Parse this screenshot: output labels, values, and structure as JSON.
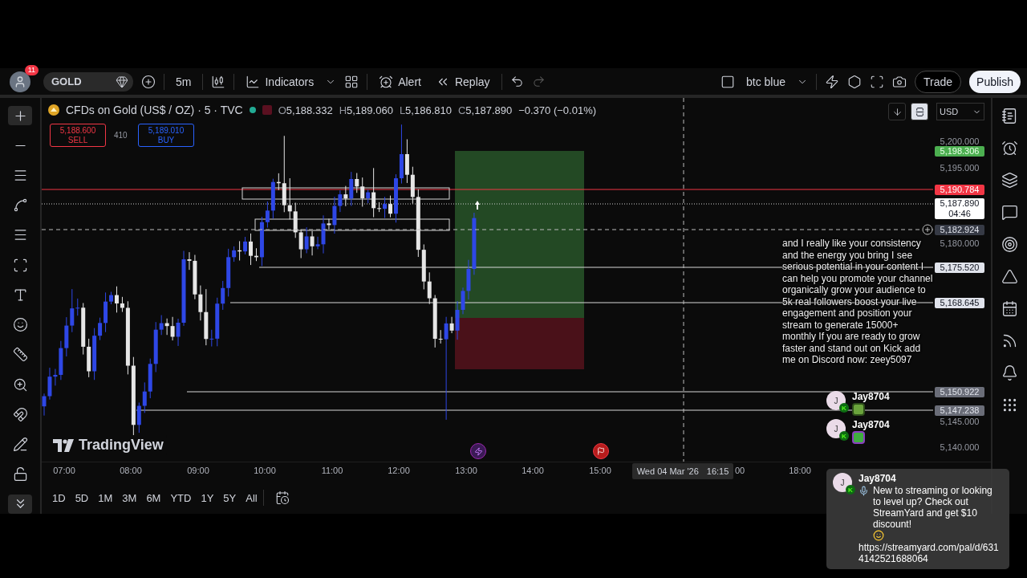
{
  "toolbar": {
    "notification_count": "11",
    "symbol": "GOLD",
    "interval": "5m",
    "indicators": "Indicators",
    "alert": "Alert",
    "replay": "Replay",
    "layout_name": "btc blue",
    "trade": "Trade",
    "publish": "Publish"
  },
  "legend": {
    "title": "CFDs on Gold (US$ / OZ) · 5 · TVC",
    "ohlc": [
      {
        "label": "O",
        "value": "5,188.332"
      },
      {
        "label": "H",
        "value": "5,189.060"
      },
      {
        "label": "L",
        "value": "5,186.810"
      },
      {
        "label": "C",
        "value": "5,187.890"
      }
    ],
    "change": "−0.370 (−0.01%)"
  },
  "order_panel": {
    "sell_price": "5,188.600",
    "sell_label": "SELL",
    "spread": "410",
    "buy_price": "5,189.010",
    "buy_label": "BUY"
  },
  "price_axis": {
    "currency": "USD",
    "labels": [
      {
        "text": "5,200.000",
        "kind": "tick"
      },
      {
        "text": "5,198.306",
        "kind": "target"
      },
      {
        "text": "5,195.000",
        "kind": "tick"
      },
      {
        "text": "5,190.784",
        "kind": "stop"
      },
      {
        "text": "5,187.890",
        "countdown": "04:46",
        "kind": "last"
      },
      {
        "text": "5,182.924",
        "kind": "crosshair"
      },
      {
        "text": "5,180.000",
        "kind": "tick"
      },
      {
        "text": "5,175.520",
        "kind": "line"
      },
      {
        "text": "5,168.645",
        "kind": "line"
      },
      {
        "text": "5,150.922",
        "kind": "muted"
      },
      {
        "text": "5,147.238",
        "kind": "muted"
      },
      {
        "text": "5,145.000",
        "kind": "tick"
      },
      {
        "text": "5,140.000",
        "kind": "tick"
      }
    ]
  },
  "brand": "TradingView",
  "time_axis": {
    "labels": [
      "07:00",
      "08:00",
      "09:00",
      "10:00",
      "11:00",
      "12:00",
      "13:00",
      "14:00",
      "15:00",
      "00",
      "18:00"
    ],
    "crosshair_date": "Wed 04 Mar '26",
    "crosshair_time": "16:15"
  },
  "ranges": [
    "1D",
    "5D",
    "1M",
    "3M",
    "6M",
    "YTD",
    "1Y",
    "5Y",
    "All"
  ],
  "chat": {
    "intro": "and I really like your consistency and the energy you bring I see serious potential in your content I can help you promote your channel organically grow your audience to 5k real followers boost your live engagement and position your stream to generate 15000+ monthly If you are ready to grow faster and stand out on Kick add me on Discord now: zeey5097",
    "messages": [
      {
        "kind": "emote",
        "avatar_letter": "J",
        "badge": "K",
        "user": "Jay8704"
      },
      {
        "kind": "emote",
        "avatar_letter": "J",
        "badge": "K",
        "user": "Jay8704"
      },
      {
        "kind": "text",
        "avatar_letter": "J",
        "badge": "K",
        "user": "Jay8704",
        "text": "New to streaming or looking to level up? Check out StreamYard and get $10 discount!",
        "link": "https://streamyard.com/pal/d/6314142521688064"
      }
    ]
  }
}
